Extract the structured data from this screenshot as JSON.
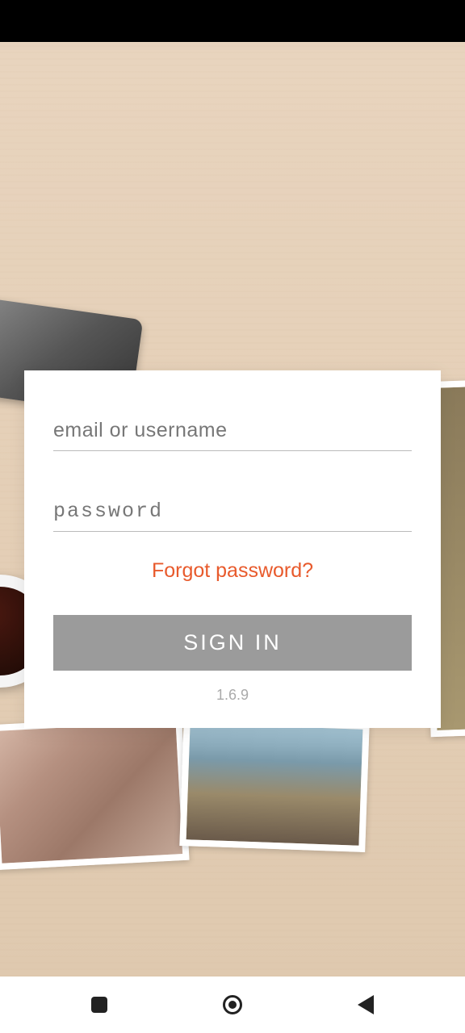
{
  "login": {
    "email_placeholder": "email or username",
    "password_placeholder": "password",
    "forgot_label": "Forgot password?",
    "signin_label": "SIGN IN",
    "version": "1.6.9"
  },
  "colors": {
    "accent": "#e85a2c",
    "button_bg": "#9b9b9b"
  }
}
